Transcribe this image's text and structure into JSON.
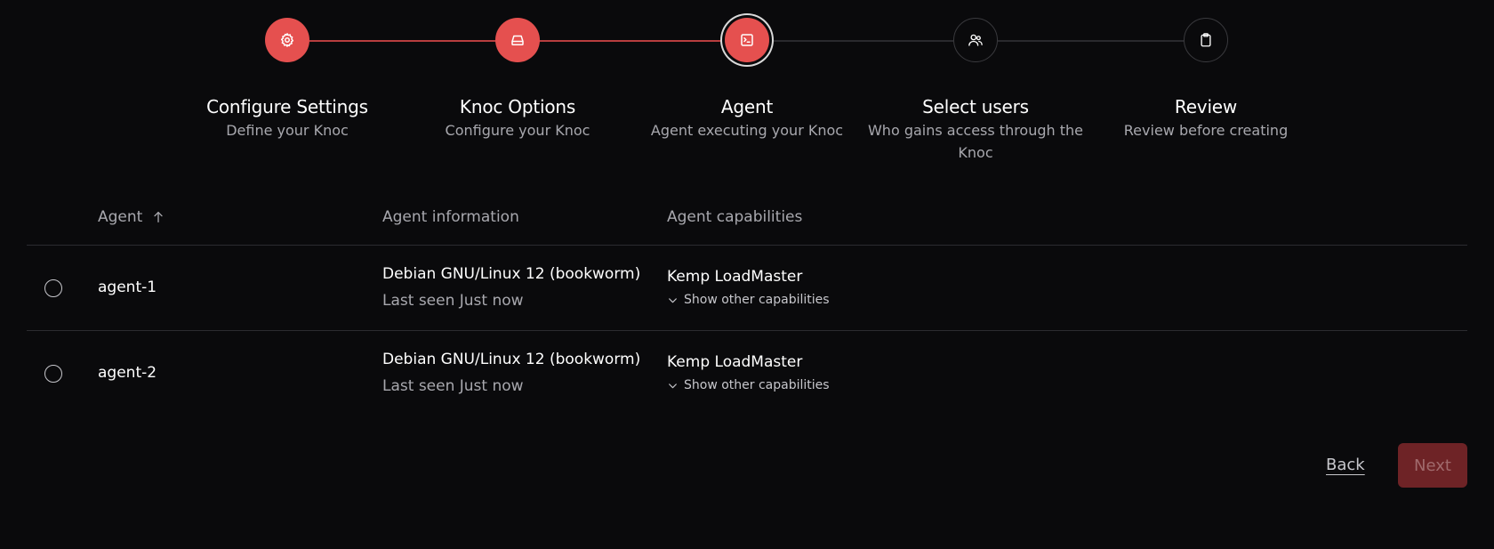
{
  "stepper": {
    "steps": [
      {
        "title": "Configure Settings",
        "subtitle": "Define your Knoc",
        "icon": "gear-icon",
        "state": "done"
      },
      {
        "title": "Knoc Options",
        "subtitle": "Configure your Knoc",
        "icon": "drive-icon",
        "state": "done"
      },
      {
        "title": "Agent",
        "subtitle": "Agent executing your Knoc",
        "icon": "terminal-icon",
        "state": "current"
      },
      {
        "title": "Select users",
        "subtitle": "Who gains access through the Knoc",
        "icon": "users-icon",
        "state": "todo"
      },
      {
        "title": "Review",
        "subtitle": "Review before creating",
        "icon": "clipboard-icon",
        "state": "todo"
      }
    ],
    "accent_color": "#e5504f"
  },
  "table": {
    "headers": {
      "agent": "Agent",
      "info": "Agent information",
      "capabilities": "Agent capabilities"
    },
    "rows": [
      {
        "name": "agent-1",
        "os": "Debian GNU/Linux 12 (bookworm)",
        "last_seen": "Last seen Just now",
        "capability": "Kemp LoadMaster",
        "more_label": "Show other capabilities"
      },
      {
        "name": "agent-2",
        "os": "Debian GNU/Linux 12 (bookworm)",
        "last_seen": "Last seen Just now",
        "capability": "Kemp LoadMaster",
        "more_label": "Show other capabilities"
      }
    ]
  },
  "footer": {
    "back_label": "Back",
    "next_label": "Next"
  }
}
